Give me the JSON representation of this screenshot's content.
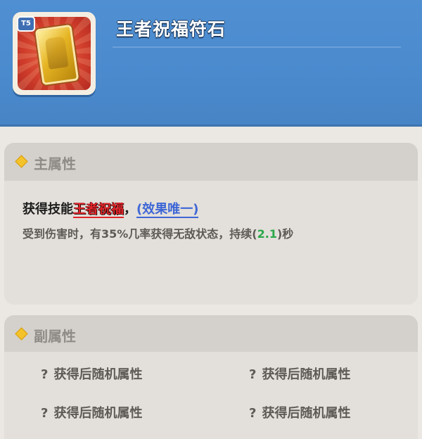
{
  "item": {
    "title": "王者祝福符石",
    "tier_badge": "T5",
    "icon": "golden-card-icon"
  },
  "main_attr": {
    "title": "主属性",
    "skill_prefix": "获得技能",
    "skill_name": "王者祝福",
    "comma": "，",
    "unique_tag": "(效果唯一)",
    "desc_before": "受到伤害时，有35%几率获得无敌状态，持续(",
    "desc_number": "2.1",
    "desc_after": ")秒"
  },
  "sub_attr": {
    "title": "副属性",
    "items": [
      {
        "q": "?",
        "label": "获得后随机属性"
      },
      {
        "q": "?",
        "label": "获得后随机属性"
      },
      {
        "q": "?",
        "label": "获得后随机属性"
      },
      {
        "q": "?",
        "label": "获得后随机属性"
      }
    ]
  },
  "colors": {
    "header_blue": "#4a8acd",
    "skill_red": "#e0252a",
    "unique_blue": "#3e66d6",
    "number_green": "#2aa84a",
    "diamond_gold": "#f4c22a"
  }
}
